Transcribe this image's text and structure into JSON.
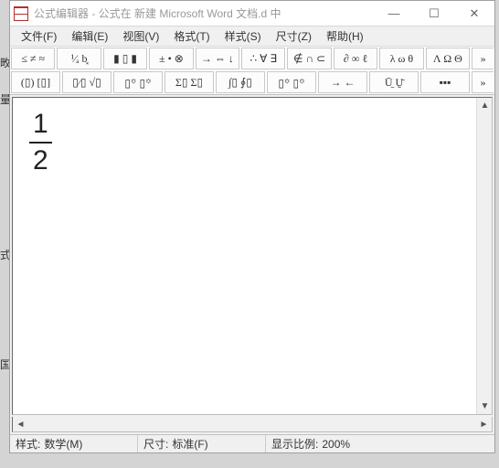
{
  "titlebar": {
    "text": "公式编辑器 - 公式在 新建 Microsoft Word 文档.d 中"
  },
  "win_buttons": {
    "min": "—",
    "max": "☐",
    "close": "✕"
  },
  "menu": [
    "文件(F)",
    "编辑(E)",
    "视图(V)",
    "格式(T)",
    "样式(S)",
    "尺寸(Z)",
    "帮助(H)"
  ],
  "toolbar_row1": [
    "≤ ≠ ≈",
    "¹⁄ₐ b͓",
    "▮ ▯ ▮",
    "± • ⊗",
    "→ ⇔ ↓",
    "∴ ∀ ∃",
    "∉ ∩ ⊂",
    "∂ ∞ ℓ",
    "λ ω θ",
    "Λ Ω Θ"
  ],
  "toolbar_row2": [
    "(▯) [▯]",
    "▯⁄▯ √▯",
    "▯꙳ ▯꙳",
    "Σ▯ Σ▯",
    "∫▯ ∮▯",
    "▯꙳ ▯꙳",
    "→ ←",
    "Ū̱ Ṵ̄",
    "▪▪▪"
  ],
  "equation": {
    "numerator": "1",
    "denominator": "2"
  },
  "status": {
    "style_label": "样式:",
    "style_value": "数学(M)",
    "size_label": "尺寸:",
    "size_value": "标准(F)",
    "zoom_label": "显示比例:",
    "zoom_value": "200%"
  },
  "bg": {
    "l1": "畋",
    "l2": "量",
    "l3": "式",
    "l4": "国"
  }
}
